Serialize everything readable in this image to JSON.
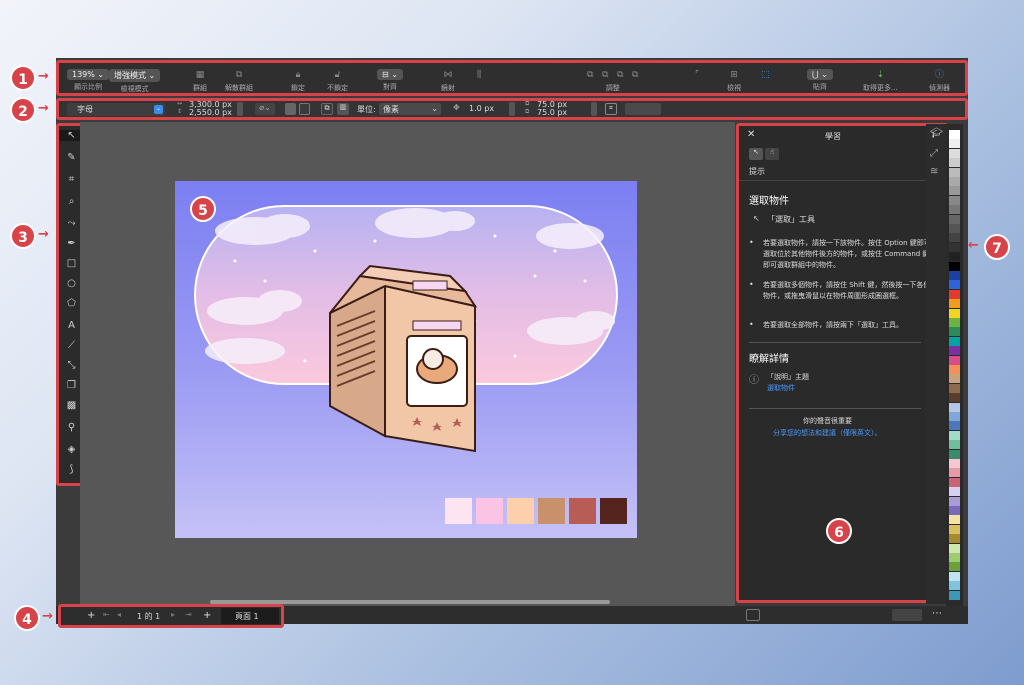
{
  "toolbar": {
    "zoom_value": "139%",
    "zoom_label": "顯示比例",
    "view_mode_value": "增強模式",
    "view_mode_label": "檢視模式",
    "group_label": "群組",
    "ungroup_label": "解散群組",
    "lock_label": "鎖定",
    "unlock_label": "不鎖定",
    "align_label": "對齊",
    "mirror_label": "鏡射",
    "adjust_label": "調整",
    "view_label": "檢視",
    "snap_label": "貼齊",
    "get_more_label": "取得更多...",
    "inspector_label": "偵測器"
  },
  "propbar": {
    "object_type": "字母",
    "width_value": "3,300.0 px",
    "height_value": "2,550.0 px",
    "unit_label": "單位:",
    "unit_value": "像素",
    "nudge_value": "1.0 px",
    "dup_x_value": "75.0 px",
    "dup_y_value": "75.0 px"
  },
  "pager": {
    "add_label": "+",
    "page_counter": "1 的 1",
    "page_tab": "頁面 1"
  },
  "learn_panel": {
    "title": "學習",
    "hints_tab": "提示",
    "heading": "選取物件",
    "tool_line": "「選取」工具",
    "bullets": [
      "若要選取物件，請按一下該物件。按住 Option 鍵即可選取位於其他物件後方的物件，或按住 Command 鍵即可選取群組中的物件。",
      "若要選取多個物件，請按住 Shift 鍵，然後按一下各個物件，或拖曳滑鼠以在物件周圍形成圈選框。",
      "若要選取全部物件，請按兩下「選取」工具。"
    ],
    "more_heading": "瞭解詳情",
    "help_topic": "「說明」主題",
    "help_link": "選取物件",
    "feedback_title": "你的聲音很重要",
    "feedback_link": "分享您的想法和建議（僅限英文）。"
  },
  "callouts": [
    "1",
    "2",
    "3",
    "4",
    "5",
    "6",
    "7"
  ],
  "colors": {
    "callout": "#d8434a",
    "accent": "#3b8bf0",
    "artwork_swatches": [
      "#fde4f1",
      "#fbc4e4",
      "#fdcfaa",
      "#c8916c",
      "#b85d56",
      "#55241f"
    ],
    "palette": [
      "#ffffff",
      "#eeeeee",
      "#dddddd",
      "#cccccc",
      "#bbbbbb",
      "#aaaaaa",
      "#999999",
      "#888888",
      "#777777",
      "#666666",
      "#555555",
      "#444444",
      "#333333",
      "#222222",
      "#000000",
      "#1b3fa3",
      "#2f63d9",
      "#e23b2e",
      "#f29c1f",
      "#f2d51f",
      "#6db33f",
      "#2e8b57",
      "#00a3a3",
      "#7b2fa0",
      "#d94c8a",
      "#f58f5a",
      "#c9a27c",
      "#8e6a4f",
      "#5a3e2b",
      "#b4c7e7",
      "#7fa6d9",
      "#4b77bd",
      "#a3d9c9",
      "#6fbf9f",
      "#3a8a6e",
      "#f7c6d0",
      "#e59aa8",
      "#c96478",
      "#d8d0f0",
      "#a99ad8",
      "#7c68b8",
      "#f4e3a1",
      "#d9bf62",
      "#a68a2e",
      "#cfe8b0",
      "#9ccc6e",
      "#6a9f3a",
      "#bfe3ef",
      "#7fc3dc",
      "#3f97b8"
    ]
  }
}
